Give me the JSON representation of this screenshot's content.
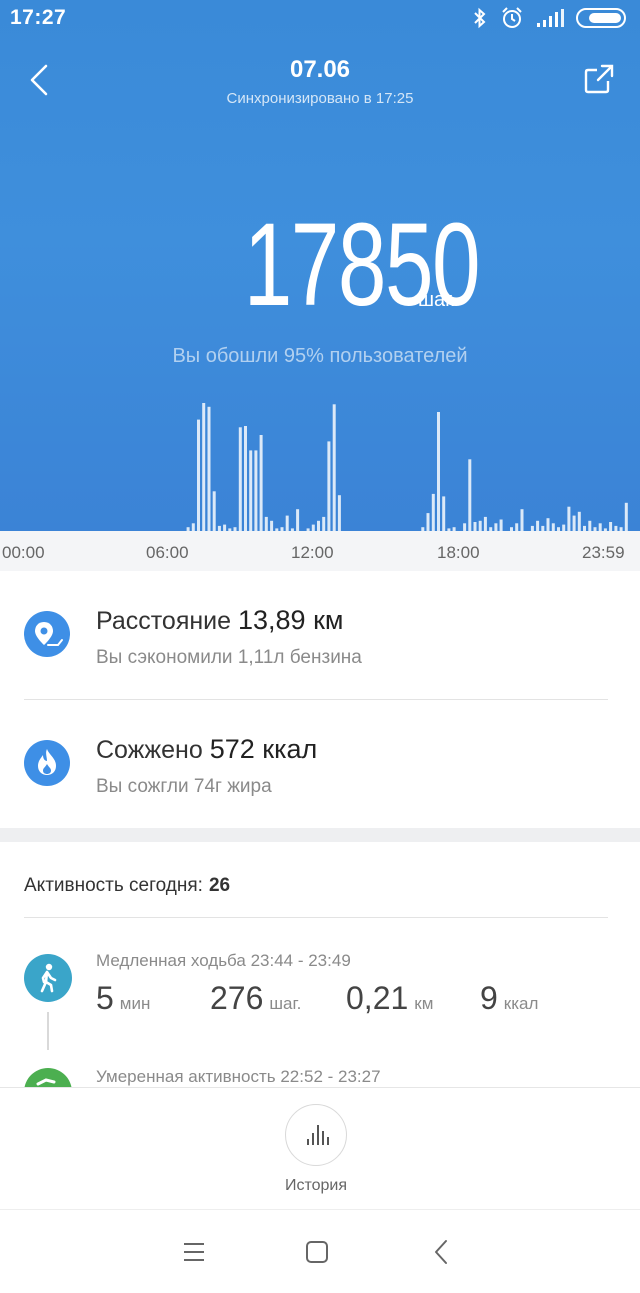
{
  "status_bar": {
    "time": "17:27",
    "icons": [
      "bluetooth-icon",
      "alarm-icon",
      "signal-icon",
      "battery-icon"
    ]
  },
  "header": {
    "date": "07.06",
    "sync_text": "Синхронизировано в 17:25"
  },
  "steps": {
    "value": "17850",
    "unit": "шаг.",
    "comparison": "Вы обошли 95% пользователей"
  },
  "chart_data": {
    "type": "bar",
    "x_tick_labels": [
      "00:00",
      "06:00",
      "12:00",
      "18:00",
      "23:59"
    ],
    "ylim": [
      0,
      1
    ],
    "bars": [
      {
        "t": 7.0,
        "v": 0.03
      },
      {
        "t": 7.2,
        "v": 0.06
      },
      {
        "t": 7.4,
        "v": 0.87
      },
      {
        "t": 7.6,
        "v": 1.0
      },
      {
        "t": 7.8,
        "v": 0.97
      },
      {
        "t": 8.0,
        "v": 0.31
      },
      {
        "t": 8.2,
        "v": 0.04
      },
      {
        "t": 8.4,
        "v": 0.05
      },
      {
        "t": 8.6,
        "v": 0.02
      },
      {
        "t": 8.8,
        "v": 0.03
      },
      {
        "t": 9.0,
        "v": 0.81
      },
      {
        "t": 9.2,
        "v": 0.82
      },
      {
        "t": 9.4,
        "v": 0.63
      },
      {
        "t": 9.6,
        "v": 0.63
      },
      {
        "t": 9.8,
        "v": 0.75
      },
      {
        "t": 10.0,
        "v": 0.11
      },
      {
        "t": 10.2,
        "v": 0.08
      },
      {
        "t": 10.4,
        "v": 0.02
      },
      {
        "t": 10.6,
        "v": 0.03
      },
      {
        "t": 10.8,
        "v": 0.12
      },
      {
        "t": 11.0,
        "v": 0.02
      },
      {
        "t": 11.2,
        "v": 0.17
      },
      {
        "t": 11.6,
        "v": 0.02
      },
      {
        "t": 11.8,
        "v": 0.05
      },
      {
        "t": 12.0,
        "v": 0.08
      },
      {
        "t": 12.2,
        "v": 0.11
      },
      {
        "t": 12.4,
        "v": 0.7
      },
      {
        "t": 12.6,
        "v": 0.99
      },
      {
        "t": 12.8,
        "v": 0.28
      },
      {
        "t": 16.0,
        "v": 0.03
      },
      {
        "t": 16.2,
        "v": 0.14
      },
      {
        "t": 16.4,
        "v": 0.29
      },
      {
        "t": 16.6,
        "v": 0.93
      },
      {
        "t": 16.8,
        "v": 0.27
      },
      {
        "t": 17.0,
        "v": 0.02
      },
      {
        "t": 17.2,
        "v": 0.03
      },
      {
        "t": 17.6,
        "v": 0.06
      },
      {
        "t": 17.8,
        "v": 0.56
      },
      {
        "t": 18.0,
        "v": 0.07
      },
      {
        "t": 18.2,
        "v": 0.08
      },
      {
        "t": 18.4,
        "v": 0.11
      },
      {
        "t": 18.6,
        "v": 0.03
      },
      {
        "t": 18.8,
        "v": 0.06
      },
      {
        "t": 19.0,
        "v": 0.09
      },
      {
        "t": 19.4,
        "v": 0.03
      },
      {
        "t": 19.6,
        "v": 0.06
      },
      {
        "t": 19.8,
        "v": 0.17
      },
      {
        "t": 20.2,
        "v": 0.04
      },
      {
        "t": 20.4,
        "v": 0.08
      },
      {
        "t": 20.6,
        "v": 0.04
      },
      {
        "t": 20.8,
        "v": 0.1
      },
      {
        "t": 21.0,
        "v": 0.06
      },
      {
        "t": 21.2,
        "v": 0.03
      },
      {
        "t": 21.4,
        "v": 0.05
      },
      {
        "t": 21.6,
        "v": 0.19
      },
      {
        "t": 21.8,
        "v": 0.12
      },
      {
        "t": 22.0,
        "v": 0.15
      },
      {
        "t": 22.2,
        "v": 0.04
      },
      {
        "t": 22.4,
        "v": 0.08
      },
      {
        "t": 22.6,
        "v": 0.03
      },
      {
        "t": 22.8,
        "v": 0.06
      },
      {
        "t": 23.0,
        "v": 0.02
      },
      {
        "t": 23.2,
        "v": 0.07
      },
      {
        "t": 23.4,
        "v": 0.04
      },
      {
        "t": 23.6,
        "v": 0.03
      },
      {
        "t": 23.8,
        "v": 0.22
      }
    ]
  },
  "distance": {
    "label": "Расстояние",
    "value": "13,89 км",
    "sub": "Вы сэкономили 1,11л бензина",
    "icon": "location-route-icon"
  },
  "calories": {
    "label": "Сожжено",
    "value": "572 ккал",
    "sub": "Вы сожгли 74г жира",
    "icon": "flame-icon"
  },
  "activity": {
    "title": "Активность сегодня:",
    "count": "26",
    "items": [
      {
        "label": "Медленная ходьба 23:44 - 23:49",
        "duration": "5",
        "duration_unit": "мин",
        "steps": "276",
        "steps_unit": "шаг.",
        "distance": "0,21",
        "distance_unit": "км",
        "calories": "9",
        "calories_unit": "ккал",
        "icon": "walking-icon",
        "color": "#3aa5c9"
      },
      {
        "label": "Умеренная активность 22:52 - 23:27",
        "icon": "running-icon",
        "color": "#4caf50"
      }
    ]
  },
  "bottom": {
    "history_label": "История"
  },
  "colors": {
    "accent": "#3e8fe6",
    "hero_top": "#3a8ad8",
    "hero_bottom": "#3b83d6"
  }
}
